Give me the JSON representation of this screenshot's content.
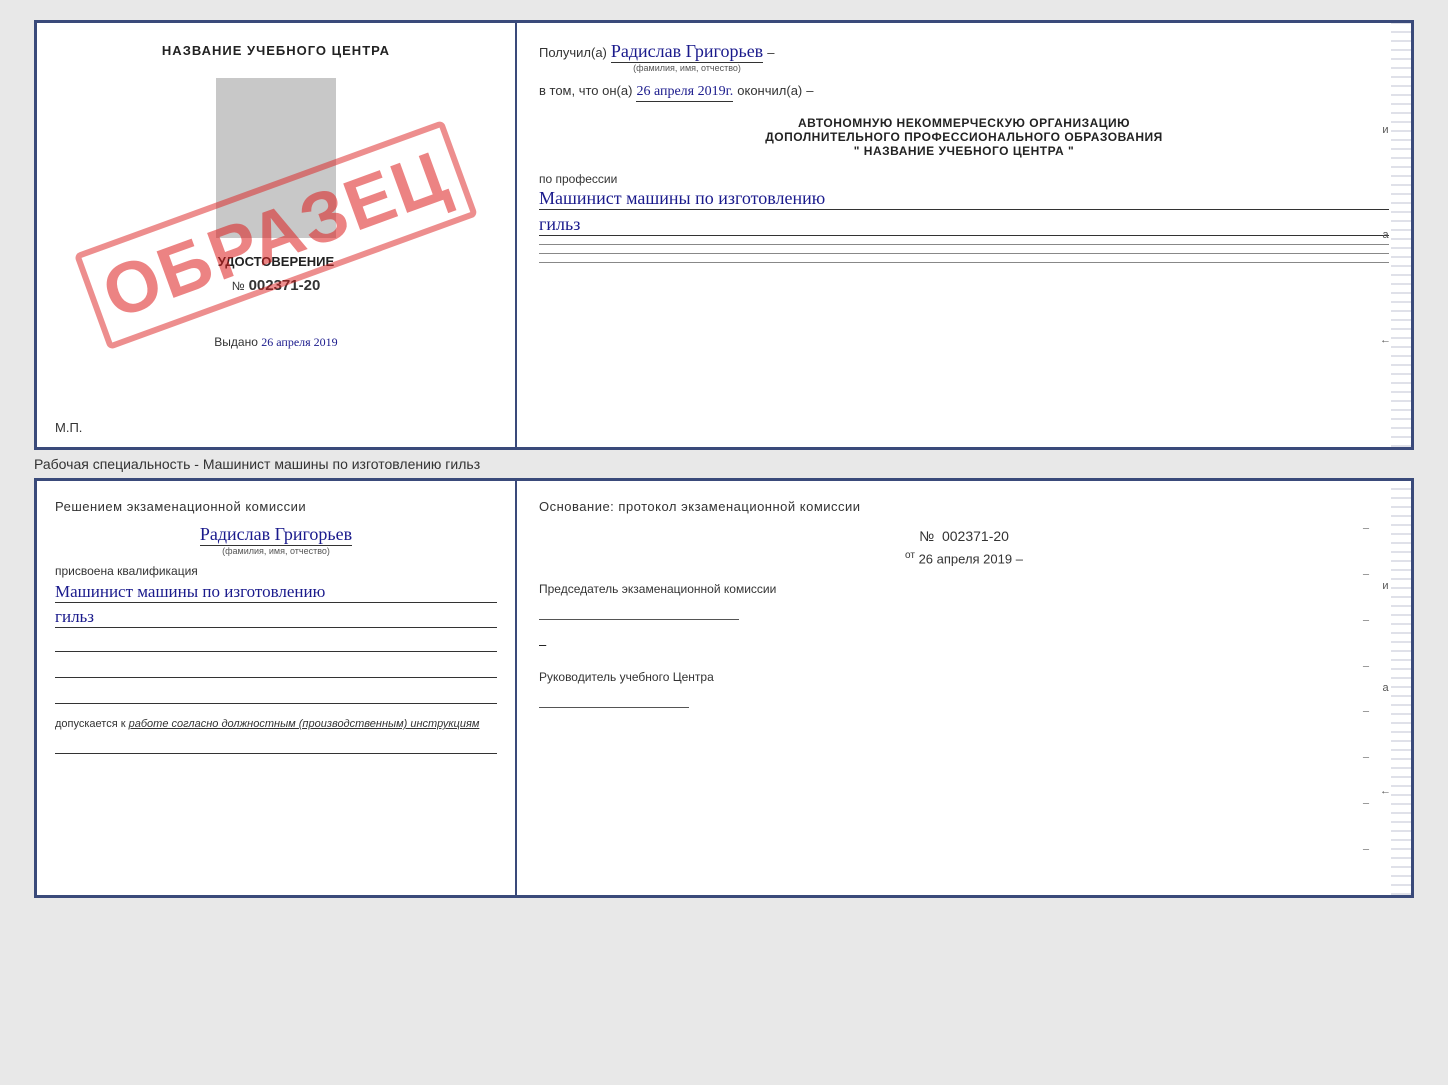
{
  "top_document": {
    "left": {
      "title": "НАЗВАНИЕ УЧЕБНОГО ЦЕНТРА",
      "stamp": "ОБРАЗЕЦ",
      "udostoverenie_label": "УДОСТОВЕРЕНИЕ",
      "number_prefix": "№",
      "number": "002371-20",
      "issued_label": "Выдано",
      "issued_date": "26 апреля 2019",
      "mp_label": "М.П."
    },
    "right": {
      "received_label": "Получил(а)",
      "name": "Радислав Григорьев",
      "name_sub": "(фамилия, имя, отчество)",
      "in_that_label": "в том, что он(а)",
      "date": "26 апреля 2019г.",
      "finished_label": "окончил(а)",
      "org_line1": "АВТОНОМНУЮ НЕКОММЕРЧЕСКУЮ ОРГАНИЗАЦИЮ",
      "org_line2": "ДОПОЛНИТЕЛЬНОГО ПРОФЕССИОНАЛЬНОГО ОБРАЗОВАНИЯ",
      "org_line3": "\"   НАЗВАНИЕ УЧЕБНОГО ЦЕНТРА   \"",
      "profession_label": "по профессии",
      "profession_line1": "Машинист машины по изготовлению",
      "profession_line2": "гильз"
    }
  },
  "caption": "Рабочая специальность - Машинист машины по изготовлению гильз",
  "bottom_document": {
    "left": {
      "decision_label": "Решением  экзаменационной  комиссии",
      "name": "Радислав Григорьев",
      "name_sub": "(фамилия, имя, отчество)",
      "assigned_label": "присвоена квалификация",
      "profession_line1": "Машинист машины по изготовлению",
      "profession_line2": "гильз",
      "допускается_prefix": "допускается к",
      "допускается_text": "работе согласно должностным (производственным) инструкциям"
    },
    "right": {
      "basis_label": "Основание: протокол экзаменационной комиссии",
      "number_prefix": "№",
      "number": "002371-20",
      "date_prefix": "от",
      "date": "26 апреля 2019",
      "chair_label": "Председатель экзаменационной комиссии",
      "руководитель_label": "Руководитель учебного Центра"
    }
  }
}
